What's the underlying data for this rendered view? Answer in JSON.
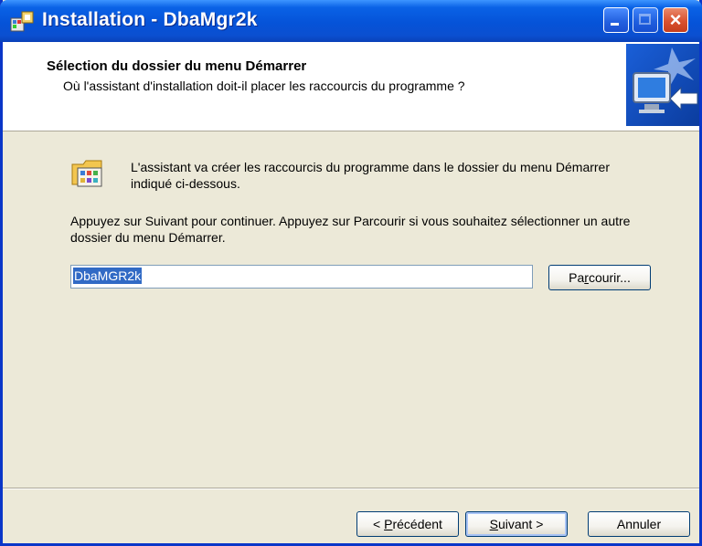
{
  "window": {
    "title": "Installation - DbaMgr2k",
    "controls": {
      "minimize": "minimize",
      "maximize": "maximize",
      "close": "×"
    }
  },
  "header": {
    "title": "Sélection du dossier du menu Démarrer",
    "subtitle": "Où l'assistant d'installation doit-il placer les raccourcis du programme ?"
  },
  "body": {
    "info": "L'assistant va créer les raccourcis du programme dans le dossier du menu Démarrer indiqué ci-dessous.",
    "instruction": "Appuyez sur Suivant pour continuer. Appuyez sur Parcourir si vous souhaitez sélectionner un autre dossier du menu Démarrer.",
    "folder_value": "DbaMGR2k"
  },
  "buttons": {
    "browse": {
      "pre": "Pa",
      "ul": "r",
      "post": "courir..."
    },
    "back": {
      "pre": "< ",
      "ul": "P",
      "post": "récédent"
    },
    "next": {
      "pre": "",
      "ul": "S",
      "post": "uivant >"
    },
    "cancel": "Annuler"
  }
}
